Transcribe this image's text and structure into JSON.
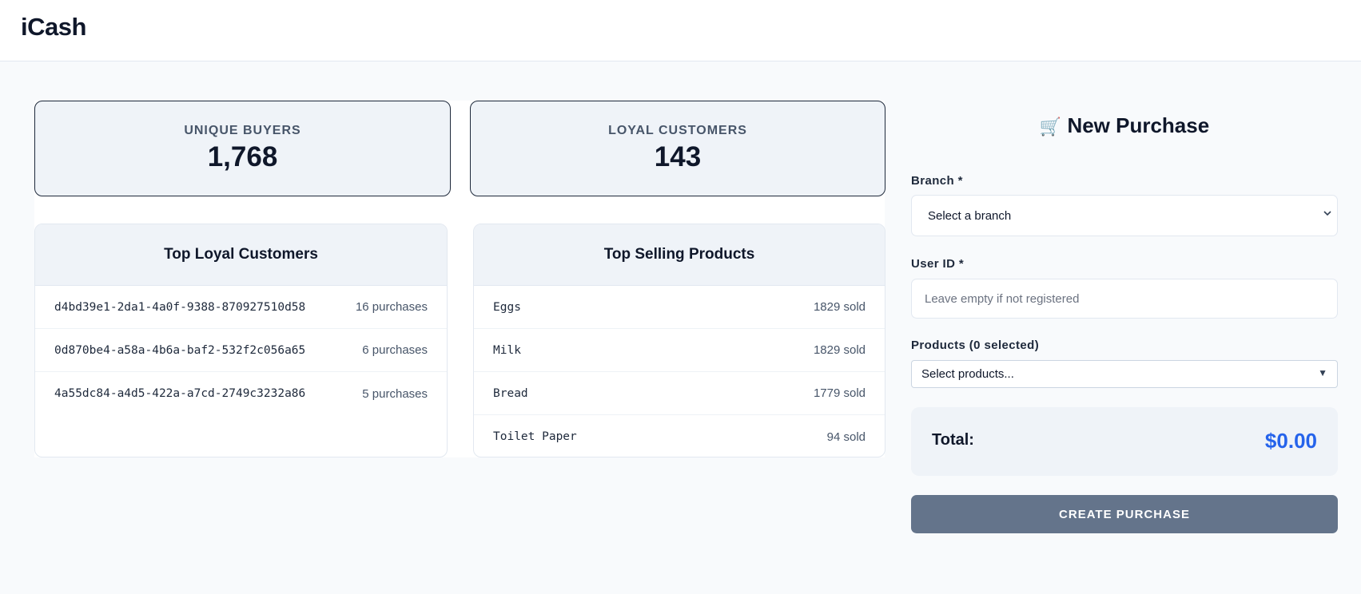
{
  "app": {
    "name": "iCash"
  },
  "stats": {
    "unique_buyers": {
      "label": "UNIQUE BUYERS",
      "value": "1,768"
    },
    "loyal_customers": {
      "label": "LOYAL CUSTOMERS",
      "value": "143"
    }
  },
  "top_loyal": {
    "title": "Top Loyal Customers",
    "rows": [
      {
        "id": "d4bd39e1-2da1-4a0f-9388-870927510d58",
        "value": "16 purchases"
      },
      {
        "id": "0d870be4-a58a-4b6a-baf2-532f2c056a65",
        "value": "6 purchases"
      },
      {
        "id": "4a55dc84-a4d5-422a-a7cd-2749c3232a86",
        "value": "5 purchases"
      }
    ]
  },
  "top_products": {
    "title": "Top Selling Products",
    "rows": [
      {
        "name": "Eggs",
        "value": "1829 sold"
      },
      {
        "name": "Milk",
        "value": "1829 sold"
      },
      {
        "name": "Bread",
        "value": "1779 sold"
      },
      {
        "name": "Toilet Paper",
        "value": "94 sold"
      }
    ]
  },
  "purchase_form": {
    "icon": "cart-icon",
    "title": "New Purchase",
    "branch_label": "Branch *",
    "branch_value": "Select a branch",
    "user_label": "User ID *",
    "user_placeholder": "Leave empty if not registered",
    "products_label": "Products (0 selected)",
    "products_value": "Select products...",
    "total_label": "Total:",
    "total_amount": "$0.00",
    "submit_label": "CREATE PURCHASE"
  },
  "colors": {
    "accent": "#2563eb",
    "button": "#64748b",
    "card_bg": "#eff3f8",
    "page_bg": "#f8fafc"
  }
}
